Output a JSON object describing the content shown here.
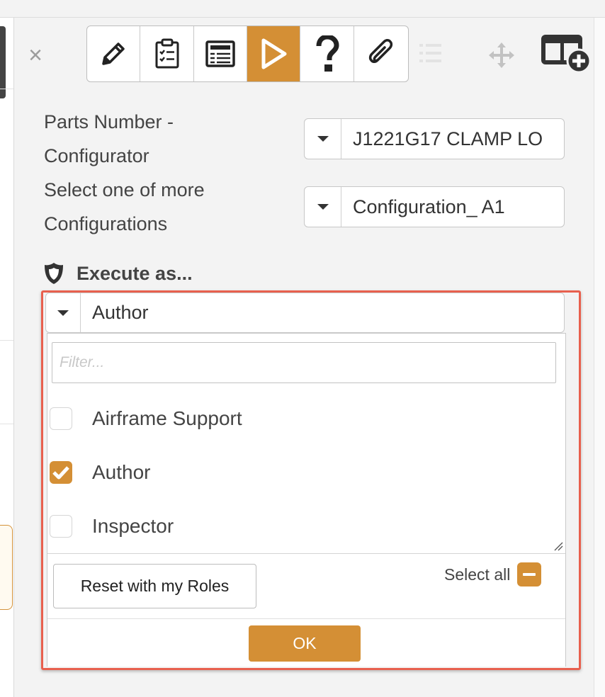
{
  "toolbar": {
    "close_symbol": "×",
    "buttons": [
      {
        "icon": "pencil-icon"
      },
      {
        "icon": "clipboard-checklist-icon"
      },
      {
        "icon": "form-list-icon"
      },
      {
        "icon": "play-icon",
        "active": true
      },
      {
        "icon": "question-icon"
      },
      {
        "icon": "paperclip-icon"
      }
    ],
    "extra_icons": [
      "list-icon",
      "move-icon",
      "add-column-icon"
    ],
    "accent_color": "#d48f35"
  },
  "form": {
    "parts_number": {
      "label_line1": "Parts Number -",
      "label_line2": "Configurator",
      "value": "J1221G17 CLAMP LO"
    },
    "configurations": {
      "label_line1": "Select one of more",
      "label_line2": "Configurations",
      "value": "Configuration_ A1"
    }
  },
  "execute_as": {
    "heading": "Execute as...",
    "selected": "Author",
    "filter_placeholder": "Filter...",
    "options": [
      {
        "label": "Airframe Support",
        "checked": false
      },
      {
        "label": "Author",
        "checked": true
      },
      {
        "label": "Inspector",
        "checked": false
      }
    ],
    "reset_label": "Reset with my Roles",
    "select_all_label": "Select all",
    "ok_label": "OK"
  },
  "colors": {
    "accent": "#d48f35",
    "highlight_border": "#e8604e"
  }
}
